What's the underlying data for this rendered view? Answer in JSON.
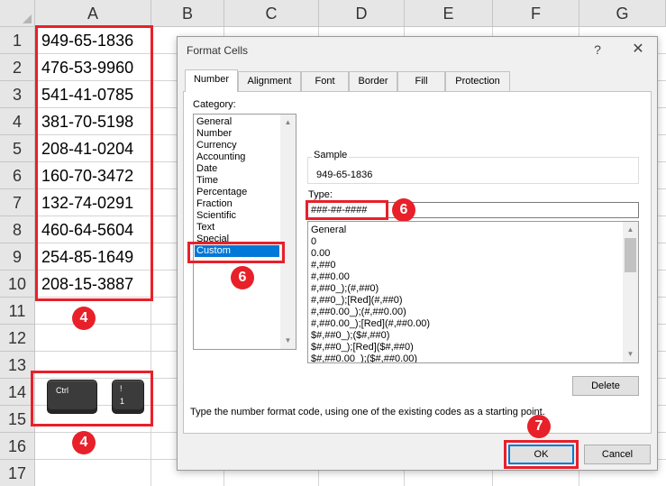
{
  "sheet": {
    "columns": [
      "A",
      "B",
      "C",
      "D",
      "E",
      "F",
      "G"
    ],
    "rows": [
      "1",
      "2",
      "3",
      "4",
      "5",
      "6",
      "7",
      "8",
      "9",
      "10",
      "11",
      "12",
      "13",
      "14",
      "15",
      "16",
      "17"
    ],
    "column_a_values": [
      "949-65-1836",
      "476-53-9960",
      "541-41-0785",
      "381-70-5198",
      "208-41-0204",
      "160-70-3472",
      "132-74-0291",
      "460-64-5604",
      "254-85-1649",
      "208-15-3887"
    ]
  },
  "keys": {
    "ctrl": "Ctrl",
    "one_top": "!",
    "one_bottom": "1"
  },
  "annotations": {
    "step4_a": "4",
    "step4_b": "4",
    "step6_category": "6",
    "step6_type": "6",
    "step7_ok": "7"
  },
  "dialog": {
    "title": "Format Cells",
    "help": "?",
    "close": "✕",
    "tabs": [
      "Number",
      "Alignment",
      "Font",
      "Border",
      "Fill",
      "Protection"
    ],
    "category_label": "Category:",
    "categories": [
      "General",
      "Number",
      "Currency",
      "Accounting",
      "Date",
      "Time",
      "Percentage",
      "Fraction",
      "Scientific",
      "Text",
      "Special",
      "Custom"
    ],
    "selected_category": "Custom",
    "sample_label": "Sample",
    "sample_value": "949-65-1836",
    "type_label": "Type:",
    "type_value": "###-##-####",
    "type_list": [
      "General",
      "0",
      "0.00",
      "#,##0",
      "#,##0.00",
      "#,##0_);(#,##0)",
      "#,##0_);[Red](#,##0)",
      "#,##0.00_);(#,##0.00)",
      "#,##0.00_);[Red](#,##0.00)",
      "$#,##0_);($#,##0)",
      "$#,##0_);[Red]($#,##0)",
      "$#,##0.00_);($#,##0.00)"
    ],
    "delete_label": "Delete",
    "hint": "Type the number format code, using one of the existing codes as a starting point.",
    "ok_label": "OK",
    "cancel_label": "Cancel"
  },
  "colors": {
    "annotation_red": "#e8202a",
    "selection_blue": "#0078d7"
  }
}
